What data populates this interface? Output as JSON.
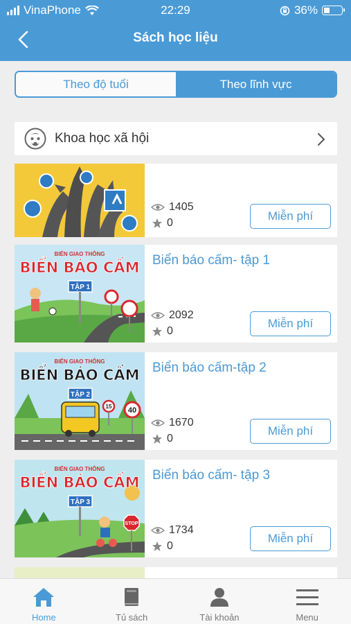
{
  "status_bar": {
    "carrier": "VinaPhone",
    "time": "22:29",
    "battery": "36%",
    "battery_level": 0.36
  },
  "header": {
    "title": "Sách học liệu"
  },
  "segments": [
    {
      "label": "Theo độ tuổi",
      "active": false
    },
    {
      "label": "Theo lĩnh vực",
      "active": true
    }
  ],
  "category": {
    "label": "Khoa học xã hội"
  },
  "books": [
    {
      "title": "",
      "views": "1405",
      "stars": "0",
      "button": "Miễn phí",
      "cover": {
        "icon": "road-signs-cover"
      }
    },
    {
      "title": "Biển báo cấm- tập 1",
      "views": "2092",
      "stars": "0",
      "button": "Miễn phí",
      "cover": {
        "kicker": "BIỂN GIAO THÔNG",
        "heading": "BIỂN BÁO CẤM",
        "vol": "TẬP 1"
      }
    },
    {
      "title": "Biển báo cấm-tập 2",
      "views": "1670",
      "stars": "0",
      "button": "Miễn phí",
      "cover": {
        "kicker": "BIỂN GIAO THÔNG",
        "heading": "BIỂN BÁO CẤM",
        "vol": "TẬP 2",
        "sign1": "15",
        "sign2": "40"
      }
    },
    {
      "title": "Biển báo cấm- tập 3",
      "views": "1734",
      "stars": "0",
      "button": "Miễn phí",
      "cover": {
        "kicker": "BIỂN GIAO THÔNG",
        "heading": "BIỂN BÁO CẤM",
        "vol": "TẬP 3",
        "sign": "STOP"
      }
    }
  ],
  "tabs": [
    {
      "label": "Home",
      "icon": "home-icon",
      "active": true
    },
    {
      "label": "Tủ sách",
      "icon": "book-icon",
      "active": false
    },
    {
      "label": "Tài khoản",
      "icon": "user-icon",
      "active": false
    },
    {
      "label": "Menu",
      "icon": "menu-icon",
      "active": false
    }
  ],
  "colors": {
    "accent": "#4a9ad6",
    "background": "#eeeeee",
    "inactive_tab": "#777777"
  }
}
